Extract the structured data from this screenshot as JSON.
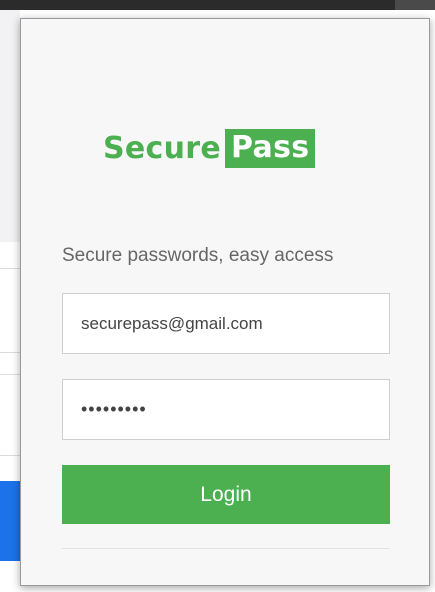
{
  "brand": {
    "name_part1": "Secure",
    "name_part2": "Pass",
    "color": "#4caf50"
  },
  "tagline": "Secure passwords, easy access",
  "login_form": {
    "email_value": "securepass@gmail.com",
    "password_value": "•••••••••",
    "login_label": "Login"
  },
  "colors": {
    "accent": "#4caf50",
    "background_page_button": "#1a73e8"
  }
}
